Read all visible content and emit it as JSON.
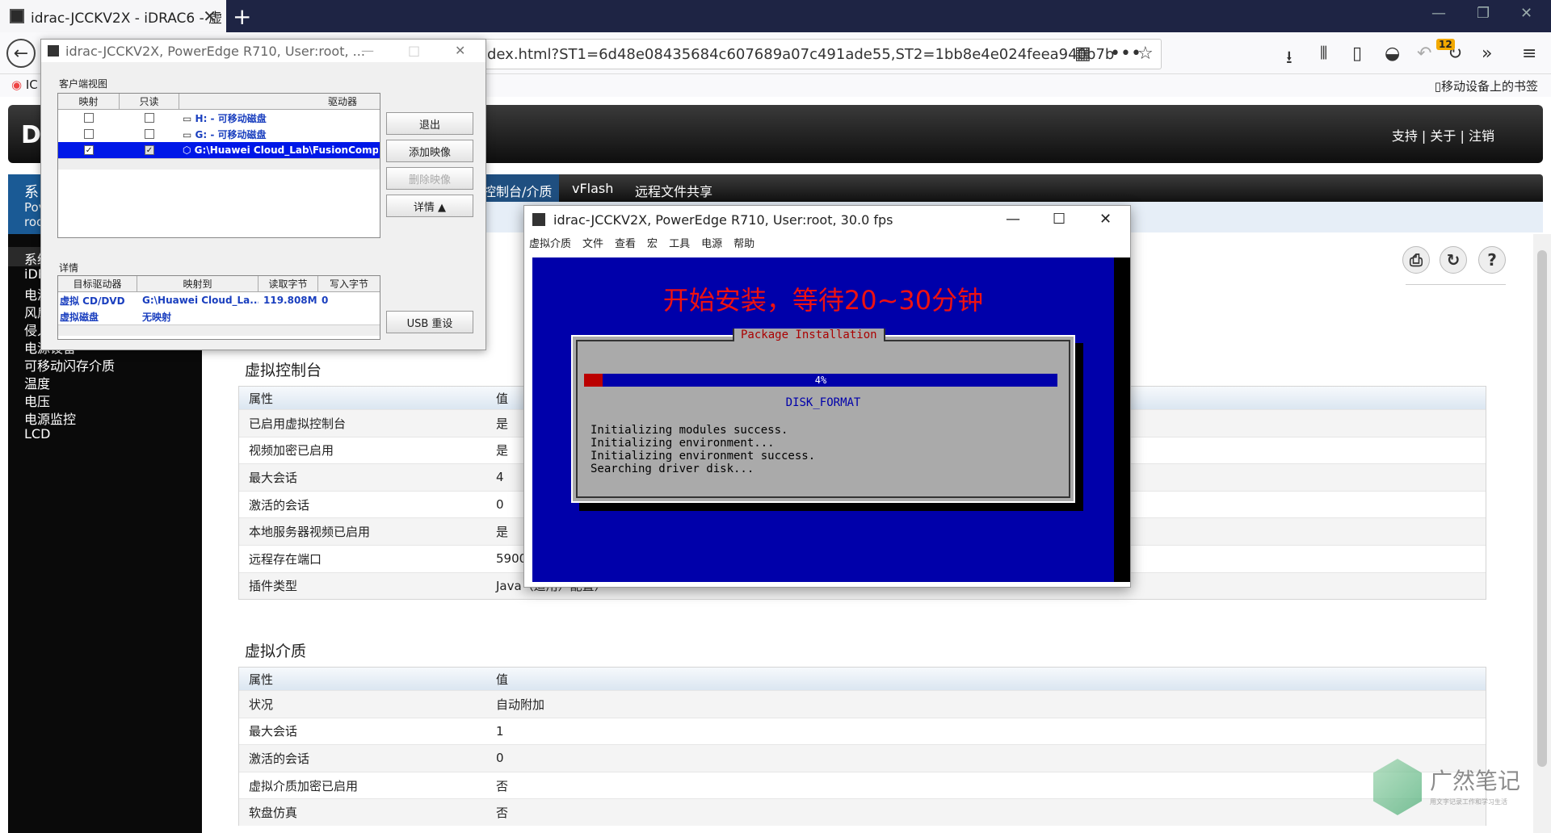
{
  "browser": {
    "tab_title": "idrac-JCCKV2X - iDRAC6 - 虚",
    "url": "dex.html?ST1=6d48e08435684c607689a07c491ade55,ST2=1bb8e4e024feea940b7b",
    "bookmark_partial": "IC",
    "mobile_bookmarks": "移动设备上的书签",
    "badge": "12"
  },
  "idrac": {
    "top_links": [
      "支持",
      "关于",
      "注销"
    ],
    "tabs": [
      "控制台/介质",
      "vFlash",
      "远程文件共享"
    ],
    "left_header": [
      "系",
      "Pov",
      "roo"
    ],
    "left_items": [
      "系统",
      "iDR",
      "电源",
      "风扇",
      "侵入",
      "电源设备",
      "可移动闪存介质",
      "温度",
      "电压",
      "电源监控",
      "LCD"
    ]
  },
  "virtual_console": {
    "title": "虚拟控制台",
    "header": [
      "属性",
      "值"
    ],
    "rows": [
      [
        "已启用虚拟控制台",
        "是"
      ],
      [
        "视频加密已启用",
        "是"
      ],
      [
        "最大会话",
        "4"
      ],
      [
        "激活的会话",
        "0"
      ],
      [
        "本地服务器视频已启用",
        "是"
      ],
      [
        "远程存在端口",
        "5900"
      ],
      [
        "插件类型",
        "Java（适用）配置）"
      ]
    ]
  },
  "virtual_media": {
    "title": "虚拟介质",
    "header": [
      "属性",
      "值"
    ],
    "rows": [
      [
        "状况",
        "自动附加"
      ],
      [
        "最大会话",
        "1"
      ],
      [
        "激活的会话",
        "0"
      ],
      [
        "虚拟介质加密已启用",
        "否"
      ],
      [
        "软盘仿真",
        "否"
      ]
    ]
  },
  "vm_dialog": {
    "title": "idrac-JCCKV2X, PowerEdge R710, User:root, ...",
    "client_view": "客户端视图",
    "cols": [
      "映射",
      "只读",
      "驱动器"
    ],
    "drives": [
      {
        "map": false,
        "ro": false,
        "name": "H: - 可移动磁盘",
        "sel": false
      },
      {
        "map": false,
        "ro": false,
        "name": "G: - 可移动磁盘",
        "sel": false
      },
      {
        "map": true,
        "ro": true,
        "name": "G:\\Huawei Cloud_Lab\\FusionCompute\\Fu",
        "sel": true
      }
    ],
    "buttons": {
      "exit": "退出",
      "add": "添加映像",
      "remove": "删除映像",
      "details": "详情 ▲",
      "usb": "USB 重设"
    },
    "details_label": "详情",
    "dcols": [
      "目标驱动器",
      "映射到",
      "读取字节",
      "写入字节"
    ],
    "drows": [
      [
        "虚拟 CD/DVD",
        "G:\\Huawei Cloud_La...",
        "119.808M",
        "0"
      ],
      [
        "虚拟磁盘",
        "无映射",
        "",
        ""
      ]
    ]
  },
  "kvm": {
    "title": "idrac-JCCKV2X, PowerEdge R710, User:root, 30.0 fps",
    "menu": [
      "虚拟介质",
      "文件",
      "查看",
      "宏",
      "工具",
      "电源",
      "帮助"
    ],
    "banner": "开始安装，等待20~30分钟",
    "box_title": "Package Installation",
    "progress": 0.04,
    "progress_label": "4%",
    "step": "DISK_FORMAT",
    "log": "Initializing modules success.\nInitializing environment...\nInitializing environment success.\nSearching driver disk..."
  },
  "watermark": {
    "title": "广然笔记",
    "sub": "用文字记录工作和学习生活"
  }
}
